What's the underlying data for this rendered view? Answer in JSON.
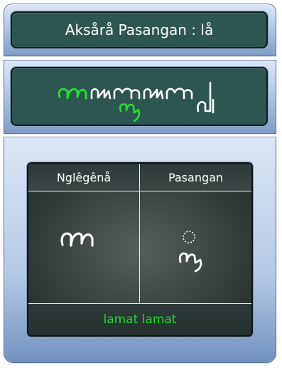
{
  "header": {
    "title": "Aksårå Pasangan : lå"
  },
  "sample": {
    "script_text": "ꦭꦩꦠ꧀ꦭꦩꦠ꧀",
    "highlight_color": "#24e02a",
    "text_color": "#ffffff"
  },
  "table": {
    "col_left_header": "Nglêgênå",
    "col_right_header": "Pasangan",
    "nglegena_glyph": "ꦭ",
    "pasangan_glyph": "꧀ꦭ",
    "reading": "lamat lamat"
  },
  "colors": {
    "display_bg": "#2d5551",
    "panel_blue": "#a9c0de",
    "reading_green": "#1ddd25"
  }
}
